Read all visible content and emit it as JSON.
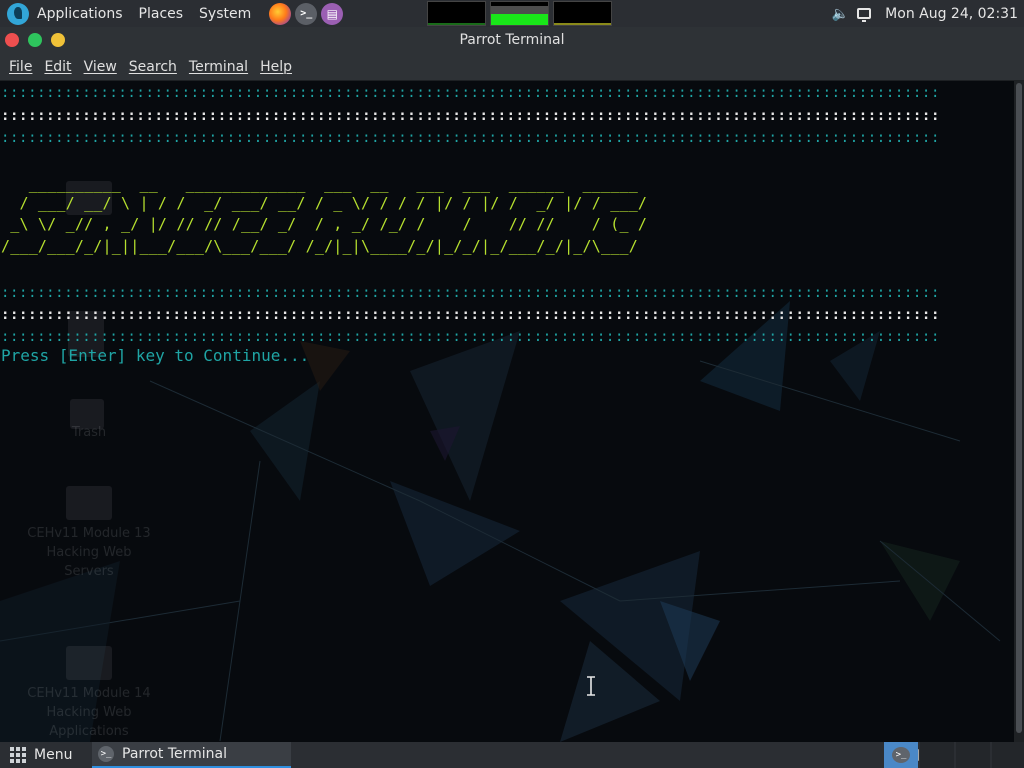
{
  "top_panel": {
    "applications_label": "Applications",
    "places_label": "Places",
    "system_label": "System",
    "launchers": [
      "firefox-icon",
      "terminal-icon",
      "text-editor-icon"
    ],
    "clock": "Mon Aug 24, 02:31",
    "tray_icons": [
      "volume-icon",
      "display-icon"
    ]
  },
  "window": {
    "title": "Parrot Terminal",
    "menu": {
      "file": "File",
      "edit": "Edit",
      "view": "View",
      "search": "Search",
      "terminal": "Terminal",
      "help": "Help"
    }
  },
  "terminal": {
    "dots_cyan": "::::::::::::::::::::::::::::::::::::::::::::::::::::::::::::::::::::::::::::::::::::::::::::::::::::::::",
    "dots_white": "::::::::::::::::::::::::::::::::::::::::::::::::::::::::::::::::::::::::::::::::::::::::::::::::::::::::",
    "ascii_art": [
      "   __________  __   _____________  ___  __   ___  ___  ______  ______",
      "  / ___/ __/ \\ | / /  _/ ___/ __/ / _ \\/ / / / |/ / |/ /  _/ |/ / ___/",
      " _\\ \\/ _// , _/ |/ // // /__/ _/  / , _/ /_/ /    /    // //    / (_ /",
      "/___/___/_/|_||___/___/\\___/___/ /_/|_|\\____/_/|_/_/|_/___/_/|_/\\___/"
    ],
    "prompt": "Press [Enter] key to Continue..."
  },
  "desktop_icons": [
    "Trash",
    "CEHv11 Module 13 Hacking Web Servers",
    "CEHv11 Module 14 Hacking Web Applications"
  ],
  "bottom_panel": {
    "menu_label": "Menu",
    "task_label": "Parrot Terminal"
  },
  "colors": {
    "panel": "#2b2e33",
    "terminal_bg": "#070a0e",
    "cyan_text": "#1fa5a5",
    "ascii_green": "#b6e02f",
    "accent": "#2f8fdf"
  }
}
